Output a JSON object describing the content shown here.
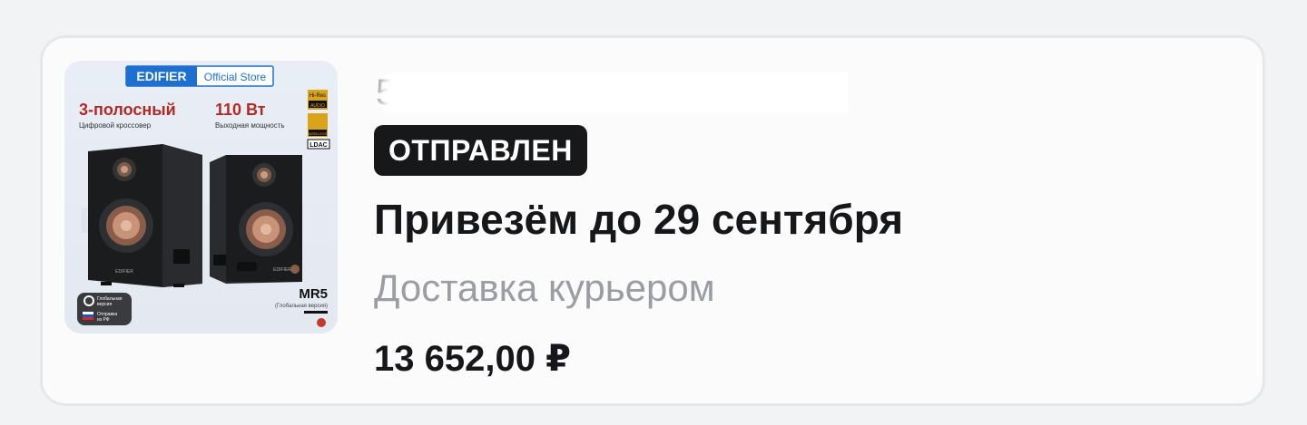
{
  "order": {
    "number_visible": "5",
    "status": "ОТПРАВЛЕН",
    "delivery_date": "Привезём до 29 сентября",
    "delivery_method": "Доставка курьером",
    "price": "13 652,00 ₽"
  },
  "product_image": {
    "brand": "EDIFIER",
    "store": "Official Store",
    "feature1_title": "3-полосный",
    "feature1_sub": "Цифровой кроссовер",
    "feature2_title": "110 Вт",
    "feature2_sub": "Выходная мощность",
    "badge_hires_top": "Hi-Res",
    "badge_hires_bottom": "AUDIO",
    "badge_wireless": "WIRELESS",
    "badge_ldac": "LDAC",
    "model": "MR5",
    "model_sub": "(Глобальная версия)",
    "global_line1": "Глобальная",
    "global_line2": "версия",
    "ship_line1": "Отправка",
    "ship_line2": "из РФ",
    "speaker_logo": "EDIFIER"
  },
  "colors": {
    "page_bg": "#f2f3f5",
    "card_bg": "#fbfbfc",
    "badge_bg": "#17181a",
    "muted_text": "#9b9da4",
    "brand_blue": "#1d6fd1",
    "accent_red": "#c0392b"
  }
}
